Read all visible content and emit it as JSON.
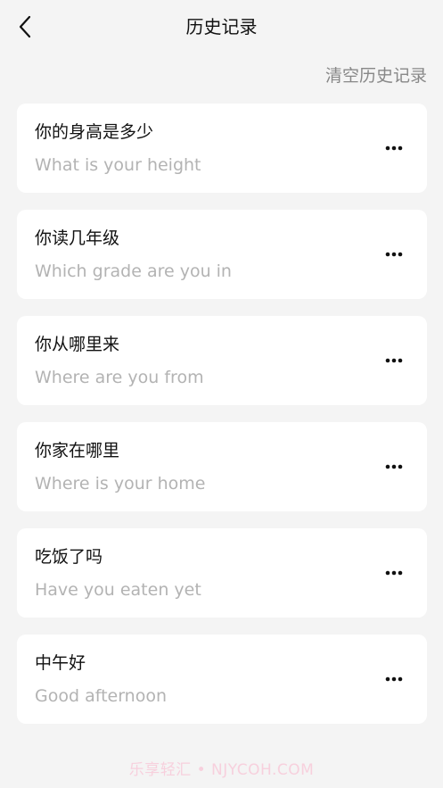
{
  "header": {
    "title": "历史记录",
    "back_icon": "chevron-left-icon"
  },
  "toolbar": {
    "clear_label": "清空历史记录"
  },
  "history": [
    {
      "cn": "你的身高是多少",
      "en": "What is your height"
    },
    {
      "cn": "你读几年级",
      "en": "Which grade are you in"
    },
    {
      "cn": "你从哪里来",
      "en": "Where are you from"
    },
    {
      "cn": "你家在哪里",
      "en": "Where is your home"
    },
    {
      "cn": "吃饭了吗",
      "en": "Have you eaten yet"
    },
    {
      "cn": "中午好",
      "en": "Good afternoon"
    }
  ],
  "more_icon": "more-horizontal-icon",
  "watermark": "乐享轻汇 • NJYCOH.COM",
  "colors": {
    "background": "#f4f4f4",
    "card": "#ffffff",
    "primary_text": "#111111",
    "secondary_text": "#b3b3b3",
    "link_text": "#888888"
  }
}
